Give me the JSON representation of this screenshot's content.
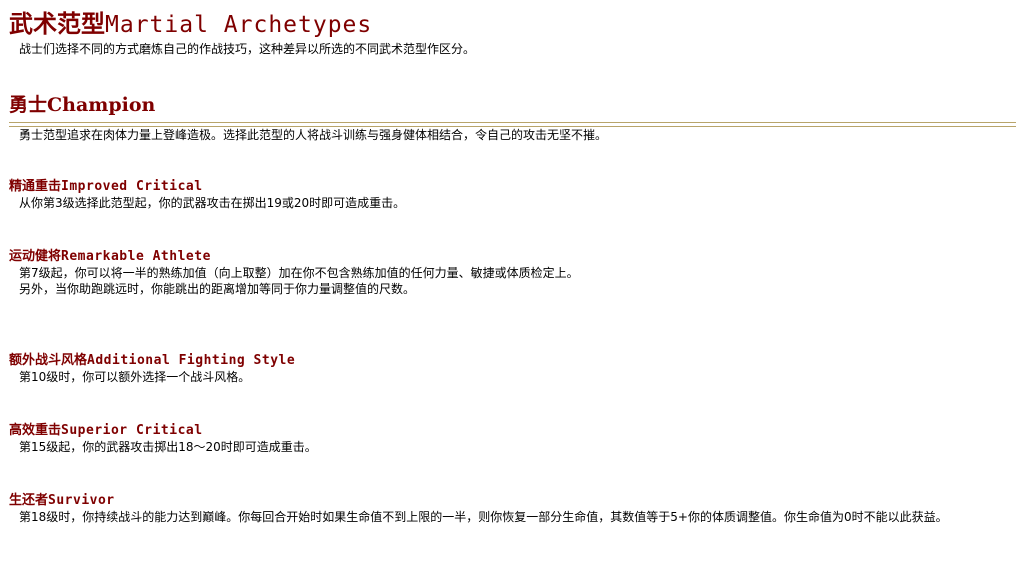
{
  "page": {
    "title_cn": "武术范型",
    "title_en": "Martial Archetypes",
    "intro": "战士们选择不同的方式磨炼自己的作战技巧，这种差异以所选的不同武术范型作区分。"
  },
  "subclass": {
    "name_cn": "勇士",
    "name_en": "Champion",
    "description": "勇士范型追求在肉体力量上登峰造极。选择此范型的人将战斗训练与强身健体相结合，令自己的攻击无坚不摧。",
    "rule_color": "#b8a46a"
  },
  "features": [
    {
      "name_cn": "精通重击",
      "name_en": "Improved Critical",
      "lines": [
        "从你第3级选择此范型起，你的武器攻击在掷出19或20时即可造成重击。"
      ]
    },
    {
      "name_cn": "运动健将",
      "name_en": "Remarkable Athlete",
      "lines": [
        "第7级起，你可以将一半的熟练加值（向上取整）加在你不包含熟练加值的任何力量、敏捷或体质检定上。",
        "另外，当你助跑跳远时，你能跳出的距离增加等同于你力量调整值的尺数。"
      ]
    },
    {
      "name_cn": "额外战斗风格",
      "name_en": "Additional Fighting Style",
      "lines": [
        "第10级时，你可以额外选择一个战斗风格。"
      ]
    },
    {
      "name_cn": "高效重击",
      "name_en": "Superior Critical",
      "lines": [
        "第15级起，你的武器攻击掷出18～20时即可造成重击。"
      ]
    },
    {
      "name_cn": "生还者",
      "name_en": "Survivor",
      "lines": [
        "第18级时，你持续战斗的能力达到巅峰。你每回合开始时如果生命值不到上限的一半，则你恢复一部分生命值，其数值等于5+你的体质调整值。你生命值为0时不能以此获益。"
      ]
    }
  ],
  "colors": {
    "heading": "#7f0000",
    "text": "#000000",
    "background": "#ffffff"
  }
}
